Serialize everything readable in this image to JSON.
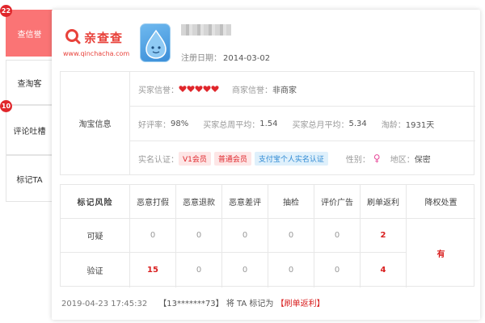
{
  "sidebar": {
    "tabs": [
      {
        "label": "查信誉",
        "active": true
      },
      {
        "label": "查淘客"
      },
      {
        "label": "评论吐槽"
      },
      {
        "label": "标记TA"
      }
    ],
    "badges": [
      "22",
      "10"
    ]
  },
  "header": {
    "logo_text": "亲查查",
    "logo_url": "www.qinchacha.com",
    "reg_label": "注册日期：",
    "reg_date": "2014-03-02"
  },
  "info": {
    "section_label": "淘宝信息",
    "buyer_credit_label": "买家信誉：",
    "buyer_credit_hearts": 5,
    "seller_credit_label": "商家信誉：",
    "seller_credit_value": "非商家",
    "good_rate_label": "好评率：",
    "good_rate_value": "98%",
    "weekly_avg_label": "买家总周平均：",
    "weekly_avg_value": "1.54",
    "monthly_avg_label": "买家总月平均：",
    "monthly_avg_value": "5.34",
    "age_label": "淘龄：",
    "age_value": "1931天",
    "realname_label": "实名认证：",
    "pills": [
      "V1会员",
      "普通会员",
      "支付宝个人实名认证"
    ],
    "gender_label": "性别：",
    "gender_symbol": "♀",
    "region_label": "地区：",
    "region_value": "保密"
  },
  "risk": {
    "title": "标记风险",
    "columns": [
      "恶意打假",
      "恶意退款",
      "恶意差评",
      "抽检",
      "评价广告",
      "刷单返利",
      "降权处置"
    ],
    "rows": [
      {
        "label": "可疑",
        "values": [
          "0",
          "0",
          "0",
          "0",
          "0",
          "2"
        ]
      },
      {
        "label": "验证",
        "values": [
          "15",
          "0",
          "0",
          "0",
          "0",
          "4"
        ]
      }
    ],
    "verdict": "有"
  },
  "footer": {
    "time": "2019-04-23 17:45:32",
    "account": "【13*******73】",
    "text": "将 TA 标记为",
    "tag": "【刷单返利】"
  },
  "colors": {
    "accent": "#fa7475",
    "danger": "#d91f1f",
    "brand": "#e8423b"
  }
}
